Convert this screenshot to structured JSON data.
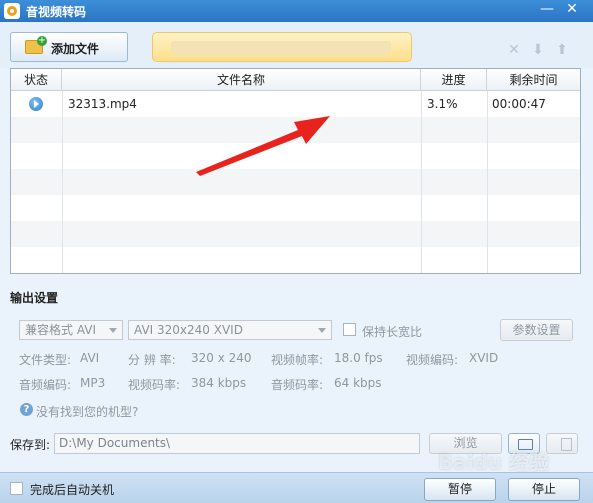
{
  "window": {
    "title": "音视频转码",
    "minimize_glyph": "—",
    "close_glyph": "✕"
  },
  "toolbar": {
    "add_file_label": "添加文件",
    "icons": [
      "folder-add-icon",
      "delete-icon",
      "move-down-icon",
      "move-up-icon"
    ]
  },
  "table": {
    "headers": {
      "status": "状态",
      "filename": "文件名称",
      "progress": "进度",
      "remaining": "剩余时间"
    },
    "rows": [
      {
        "status_icon": "play-arrow-icon",
        "filename": "32313.mp4",
        "progress": "3.1%",
        "remaining": "00:00:47"
      }
    ]
  },
  "output": {
    "section_title": "输出设置",
    "format_select": "兼容格式 AVI",
    "profile_select": "AVI 320x240 XVID",
    "keep_ratio_label": "保持长宽比",
    "params_button": "参数设置",
    "info_row1": [
      {
        "label": "文件类型:",
        "value": "AVI"
      },
      {
        "label": "分 辨 率:",
        "value": "320 x 240"
      },
      {
        "label": "视频帧率:",
        "value": "18.0 fps"
      },
      {
        "label": "视频编码:",
        "value": "XVID"
      }
    ],
    "info_row2": [
      {
        "label": "音频编码:",
        "value": "MP3"
      },
      {
        "label": "视频码率:",
        "value": "384 kbps"
      },
      {
        "label": "音频码率:",
        "value": "64 kbps"
      }
    ],
    "help_text": "没有找到您的机型?"
  },
  "save": {
    "label": "保存到:",
    "path": "D:\\My Documents\\",
    "browse_button": "浏览"
  },
  "bottom": {
    "auto_shutdown_label": "完成后自动关机",
    "pause_button": "暂停",
    "stop_button": "停止"
  },
  "watermark": "Baidu 经验",
  "colors": {
    "titlebar": "#2f7fcd",
    "accent_arrow": "#e8231d",
    "banner": "#ffe39a"
  }
}
